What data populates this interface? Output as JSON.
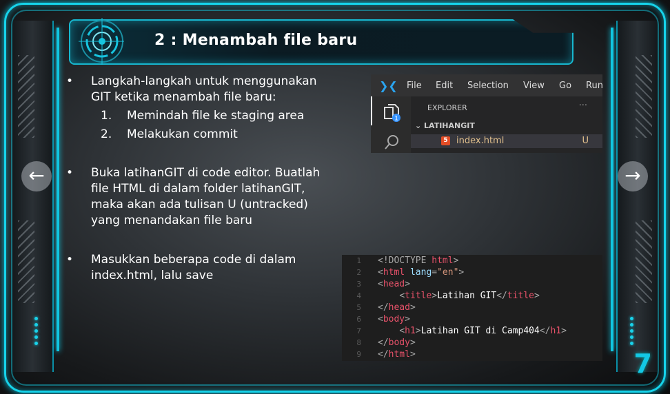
{
  "slide": {
    "title": "2 : Menambah file baru",
    "page_number": "7",
    "bullets": [
      {
        "dot": "•",
        "lines": [
          "Langkah-langkah untuk menggunakan",
          "GIT ketika menambah file baru:"
        ]
      },
      {
        "dot": "•",
        "lines": [
          "Buka latihanGIT di code editor. Buatlah",
          "file HTML di dalam folder latihanGIT,",
          "maka akan ada tulisan U (untracked)",
          "yang menandakan file baru"
        ]
      },
      {
        "dot": "•",
        "lines": [
          "Masukkan beberapa code di dalam",
          "index.html, lalu save"
        ]
      }
    ],
    "steps": [
      {
        "num": "1.",
        "text": "Memindah file ke staging area"
      },
      {
        "num": "2.",
        "text": "Melakukan commit"
      }
    ],
    "nav": {
      "prev": "←",
      "next": "→"
    }
  },
  "vscode": {
    "menu": [
      "File",
      "Edit",
      "Selection",
      "View",
      "Go",
      "Run"
    ],
    "explorer_label": "EXPLORER",
    "more": "···",
    "folder": "LATIHANGIT",
    "file": "index.html",
    "file_status": "U",
    "badge": "1"
  },
  "code": {
    "line_numbers": [
      "1",
      "2",
      "3",
      "4",
      "5",
      "6",
      "7",
      "8",
      "9"
    ],
    "lines": [
      {
        "open": "<!DOCTYPE ",
        "tag": "html",
        "close": ">"
      },
      {
        "open": "<",
        "tag": "html",
        "attr": " lang",
        "eq": "=",
        "str": "\"en\"",
        "close": ">"
      },
      {
        "open": "<",
        "tag": "head",
        "close": ">"
      },
      {
        "indent": "    ",
        "open": "<",
        "tag": "title",
        "close": ">",
        "text": "Latihan GIT",
        "end_open": "</",
        "end_tag": "title",
        "end_close": ">"
      },
      {
        "open": "</",
        "tag": "head",
        "close": ">"
      },
      {
        "open": "<",
        "tag": "body",
        "close": ">"
      },
      {
        "indent": "    ",
        "open": "<",
        "tag": "h1",
        "close": ">",
        "text": "Latihan GIT di Camp404",
        "end_open": "</",
        "end_tag": "h1",
        "end_close": ">"
      },
      {
        "open": "</",
        "tag": "body",
        "close": ">"
      },
      {
        "open": "</",
        "tag": "html",
        "close": ">"
      }
    ]
  },
  "colors": {
    "accent": "#16d3ea",
    "tag": "#e8526a",
    "string": "#ce9178",
    "untracked": "#e2c08d"
  }
}
